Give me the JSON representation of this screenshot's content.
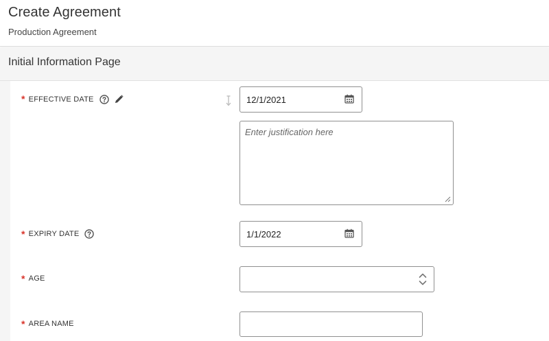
{
  "header": {
    "title": "Create Agreement",
    "subtitle": "Production Agreement"
  },
  "section": {
    "title": "Initial Information Page"
  },
  "fields": {
    "effective_date": {
      "label": "EFFECTIVE DATE",
      "required_mark": "*",
      "value": "12/1/2021",
      "justification_placeholder": "Enter justification here"
    },
    "expiry_date": {
      "label": "EXPIRY DATE",
      "required_mark": "*",
      "value": "1/1/2022"
    },
    "age": {
      "label": "AGE",
      "required_mark": "*",
      "value": ""
    },
    "area_name": {
      "label": "AREA NAME",
      "required_mark": "*",
      "value": ""
    }
  },
  "colors": {
    "required": "#d9342b",
    "border": "#8f8f8f",
    "section_bg": "#f5f5f5"
  }
}
